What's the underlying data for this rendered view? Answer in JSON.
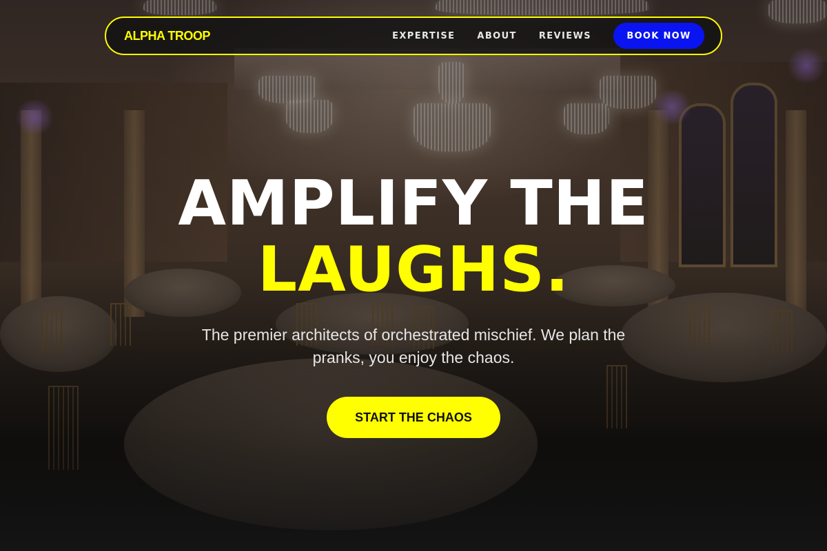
{
  "brand": {
    "name": "ALPHA TROOP"
  },
  "nav": {
    "links": [
      "EXPERTISE",
      "ABOUT",
      "REVIEWS"
    ],
    "cta_label": "BOOK NOW"
  },
  "hero": {
    "title_line1": "AMPLIFY THE",
    "title_line2": "LAUGHS.",
    "subtitle": "The premier architects of orchestrated mischief. We plan the pranks, you enjoy the chaos.",
    "cta_label": "START THE CHAOS",
    "background": "ballroom-photo"
  },
  "colors": {
    "accent": "#ffff00",
    "button_blue": "#0a14f0",
    "nav_bg": "#121212",
    "text_light": "#ffffff"
  }
}
